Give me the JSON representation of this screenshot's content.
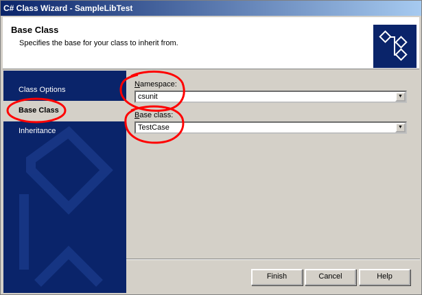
{
  "window": {
    "title": "C# Class Wizard - SampleLibTest"
  },
  "header": {
    "title": "Base Class",
    "subtitle": "Specifies the base for your class to inherit from.",
    "icon": "class-hierarchy-icon"
  },
  "sidebar": {
    "items": [
      {
        "label": "Class Options",
        "selected": false
      },
      {
        "label": "Base Class",
        "selected": true
      },
      {
        "label": "Inheritance",
        "selected": false
      }
    ]
  },
  "form": {
    "namespace_label_accel": "N",
    "namespace_label_rest": "amespace:",
    "namespace_value": "csunit",
    "baseclass_label_accel": "B",
    "baseclass_label_rest": "ase class:",
    "baseclass_value": "TestCase"
  },
  "buttons": {
    "finish": "Finish",
    "cancel": "Cancel",
    "help": "Help"
  },
  "colors": {
    "titlebar": "#0a246a",
    "sidebar": "#0a246a",
    "face": "#d4d0c8",
    "annotation": "#ff0000"
  }
}
